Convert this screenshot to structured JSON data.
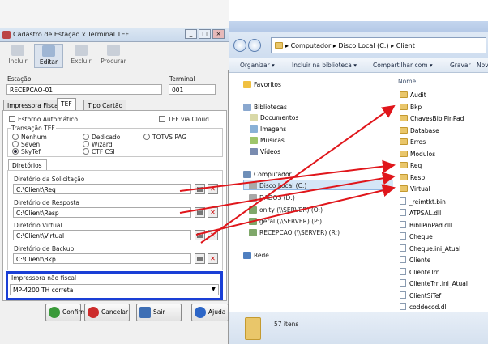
{
  "win1": {
    "title": "Cadastro de Estação x Terminal TEF",
    "toolbar": [
      {
        "label": "Incluir"
      },
      {
        "label": "Editar"
      },
      {
        "label": "Excluir"
      },
      {
        "label": "Procurar"
      }
    ],
    "estacao_label": "Estação",
    "estacao_value": "RECEPCAO-01",
    "terminal_label": "Terminal",
    "terminal_value": "001",
    "tabs": [
      "Impressora Fiscal",
      "TEF",
      "Tipo Cartão"
    ],
    "estorno": "Estorno Automático",
    "tef_cloud": "TEF via Cloud",
    "transacao_label": "Transação TEF",
    "radios": [
      "Nenhum",
      "Seven",
      "SkyTef",
      "Dedicado",
      "Wizard",
      "CTF CSI",
      "TOTVS PAG"
    ],
    "diretorios_tab": "Diretórios",
    "dirs": [
      {
        "label": "Diretório da Solicitação",
        "value": "C:\\Client\\Req"
      },
      {
        "label": "Diretório de Resposta",
        "value": "C:\\Client\\Resp"
      },
      {
        "label": "Diretório Virtual",
        "value": "C:\\Client\\Virtual"
      },
      {
        "label": "Diretório de Backup",
        "value": "C:\\Client\\Bkp"
      }
    ],
    "impressora_label": "Impressora não fiscal",
    "impressora_value": "MP-4200 TH  correta",
    "buttons": [
      "Confirmar",
      "Cancelar",
      "Sair",
      "Ajuda"
    ]
  },
  "win2": {
    "breadcrumb": [
      "Computador",
      "Disco Local (C:)",
      "Client"
    ],
    "cmd": [
      "Organizar ▾",
      "Incluir na biblioteca ▾",
      "Compartilhar com ▾",
      "Gravar",
      "Nova"
    ],
    "nav": {
      "favoritos": "Favoritos",
      "bibliotecas": "Bibliotecas",
      "libs": [
        "Documentos",
        "Imagens",
        "Músicas",
        "Vídeos"
      ],
      "computador": "Computador",
      "drives": [
        "Disco Local (C:)",
        "DADOS (D:)",
        "onity (\\\\SERVER) (O:)",
        "geral (\\\\SERVER) (P:)",
        "RECEPCAO (\\\\SERVER) (R:)"
      ],
      "rede": "Rede"
    },
    "col_name": "Nome",
    "items": [
      {
        "name": "Audit",
        "type": "folder"
      },
      {
        "name": "Bkp",
        "type": "folder"
      },
      {
        "name": "ChavesBiblPinPad",
        "type": "folder"
      },
      {
        "name": "Database",
        "type": "folder"
      },
      {
        "name": "Erros",
        "type": "folder"
      },
      {
        "name": "Modulos",
        "type": "folder"
      },
      {
        "name": "Req",
        "type": "folder"
      },
      {
        "name": "Resp",
        "type": "folder"
      },
      {
        "name": "Virtual",
        "type": "folder"
      },
      {
        "name": "_reimtkt.bin",
        "type": "file"
      },
      {
        "name": "ATPSAL.dll",
        "type": "file"
      },
      {
        "name": "BibliPinPad.dll",
        "type": "file"
      },
      {
        "name": "Cheque",
        "type": "file"
      },
      {
        "name": "Cheque.ini_Atual",
        "type": "file"
      },
      {
        "name": "Cliente",
        "type": "file"
      },
      {
        "name": "ClienteTrn",
        "type": "file"
      },
      {
        "name": "ClienteTrn.ini_Atual",
        "type": "file"
      },
      {
        "name": "ClientSiTef",
        "type": "file"
      },
      {
        "name": "coddecod.dll",
        "type": "file"
      }
    ],
    "status": "57 itens"
  },
  "colors": {
    "arrow": "#e0161b",
    "highlight_box": "#1a3fd6"
  }
}
